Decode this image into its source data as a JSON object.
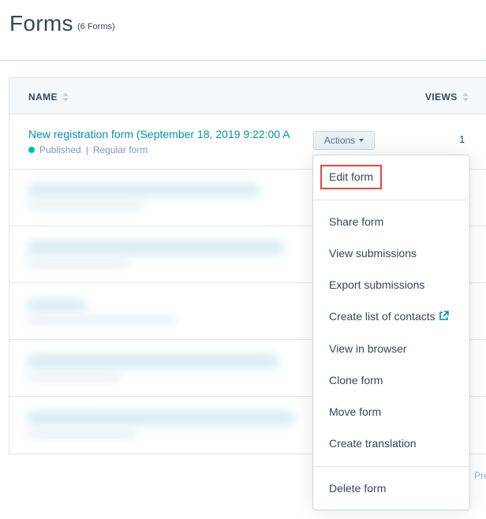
{
  "header": {
    "title": "Forms",
    "count": "(6 Forms)"
  },
  "table": {
    "columns": [
      "NAME",
      "VIEWS"
    ],
    "rows": [
      {
        "name": "New registration form (September 18, 2019 9:22:00 A",
        "status": "Published",
        "type": "Regular form",
        "actions_label": "Actions",
        "views": "1"
      }
    ]
  },
  "dropdown": {
    "items": [
      "Edit form",
      "Share form",
      "View submissions",
      "Export submissions",
      "Create list of contacts",
      "View in browser",
      "Clone form",
      "Move form",
      "Create translation",
      "Delete form"
    ]
  },
  "pagination": {
    "partial_label": "Pre"
  },
  "colors": {
    "link": "#0091ae",
    "published": "#00bda5",
    "highlight": "#e5483e"
  }
}
